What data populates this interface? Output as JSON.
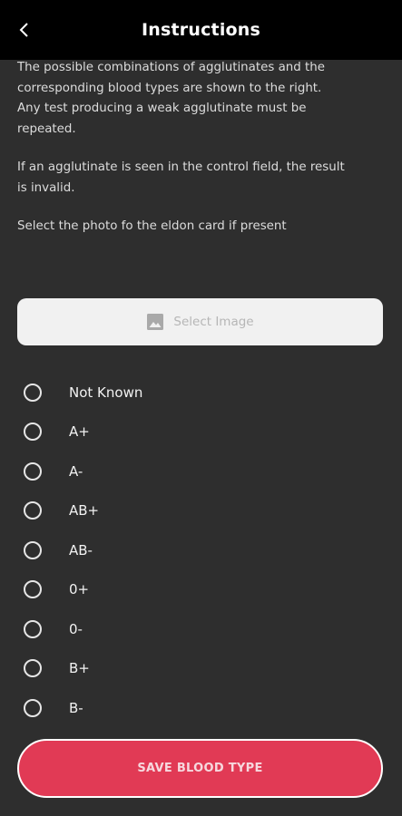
{
  "header": {
    "title": "Instructions",
    "back_icon": "chevron-left-icon"
  },
  "instructions": {
    "paragraph1_line1": "The possible combinations of agglutinates and the",
    "paragraph1_line2": "corresponding blood types are shown to the right.",
    "paragraph1_line3": "Any test producing a weak agglutinate must be",
    "paragraph1_line4": "repeated.",
    "paragraph2_line1": "If an agglutinate is seen in the control field, the result",
    "paragraph2_line2": "is invalid.",
    "paragraph3_line1": "Select the photo fo the eldon card if present"
  },
  "select_image": {
    "label": "Select Image",
    "icon": "image-icon"
  },
  "blood_types": [
    {
      "label": "Not Known",
      "selected": false
    },
    {
      "label": "A+",
      "selected": false
    },
    {
      "label": "A-",
      "selected": false
    },
    {
      "label": "AB+",
      "selected": false
    },
    {
      "label": "AB-",
      "selected": false
    },
    {
      "label": "0+",
      "selected": false
    },
    {
      "label": "0-",
      "selected": false
    },
    {
      "label": "B+",
      "selected": false
    },
    {
      "label": "B-",
      "selected": false
    }
  ],
  "save_button": {
    "label": "SAVE BLOOD TYPE"
  },
  "colors": {
    "background": "#2e2e2e",
    "header": "#000000",
    "accent": "#e13a55",
    "select_button_bg": "#f1f1f1"
  }
}
